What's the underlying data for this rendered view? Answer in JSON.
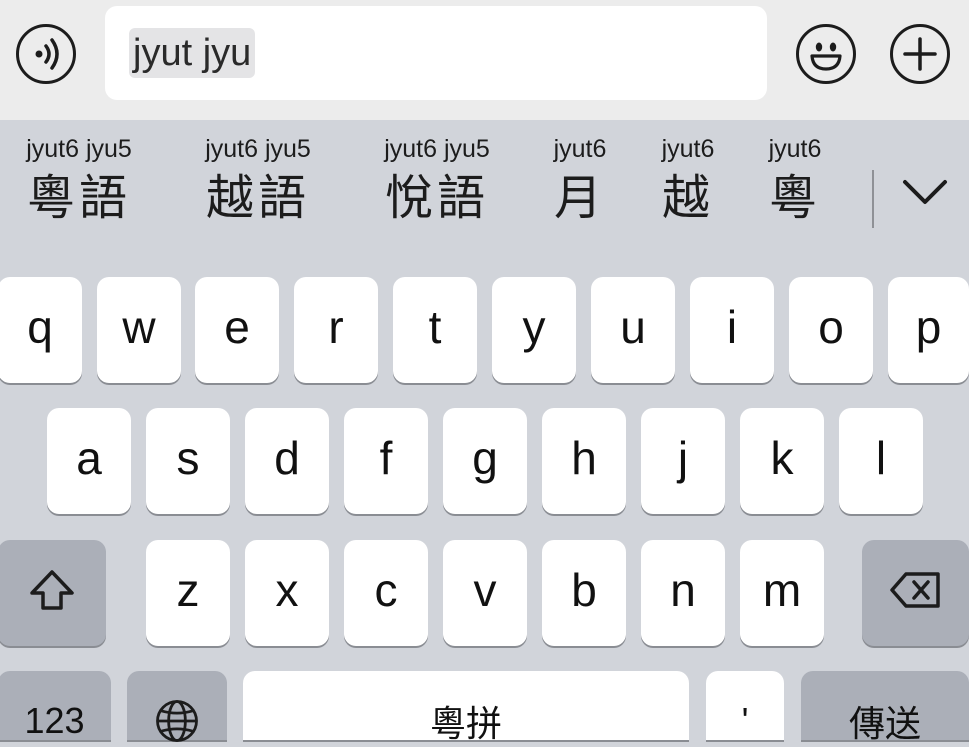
{
  "input": {
    "text": "jyut jyu"
  },
  "toolbar": {
    "voice_icon": "voice-sound-icon",
    "emoji_icon": "smiley-face-icon",
    "add_icon": "plus-icon"
  },
  "candidates": [
    {
      "romanization": "jyut6 jyu5",
      "characters": "粵語"
    },
    {
      "romanization": "jyut6 jyu5",
      "characters": "越語"
    },
    {
      "romanization": "jyut6 jyu5",
      "characters": "悅語"
    },
    {
      "romanization": "jyut6",
      "characters": "月"
    },
    {
      "romanization": "jyut6",
      "characters": "越"
    },
    {
      "romanization": "jyut6",
      "characters": "粵"
    }
  ],
  "keyboard": {
    "row1": [
      "q",
      "w",
      "e",
      "r",
      "t",
      "y",
      "u",
      "i",
      "o",
      "p"
    ],
    "row2": [
      "a",
      "s",
      "d",
      "f",
      "g",
      "h",
      "j",
      "k",
      "l"
    ],
    "row3": [
      "z",
      "x",
      "c",
      "v",
      "b",
      "n",
      "m"
    ],
    "numbers_label": "123",
    "space_label": "粵拼",
    "apostrophe_label": "'",
    "send_label": "傳送"
  }
}
